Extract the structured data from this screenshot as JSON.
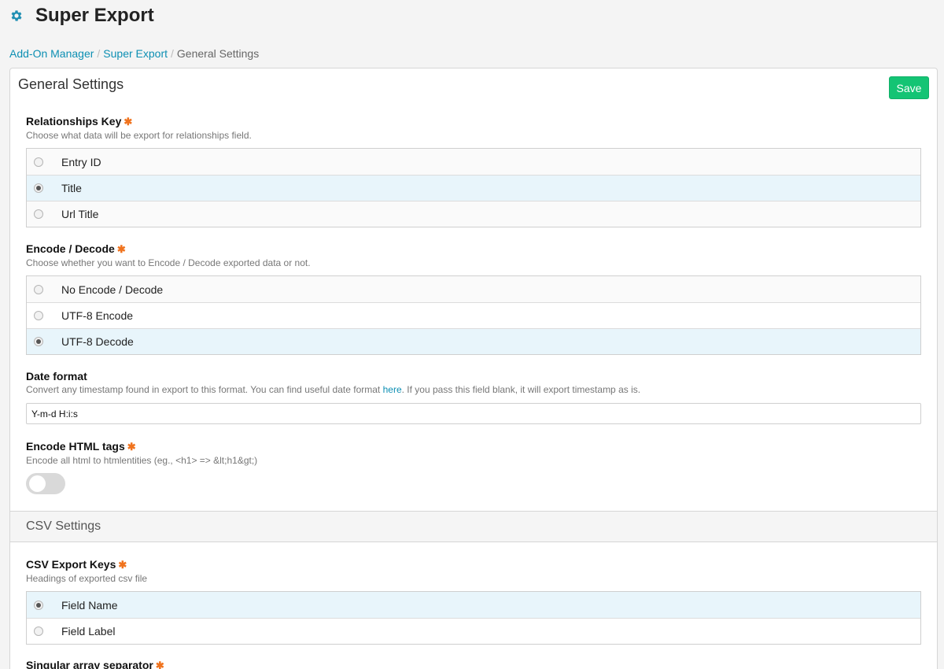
{
  "header": {
    "title": "Super Export",
    "icon": "gear-icon",
    "icon_color": "#1f8fb3"
  },
  "breadcrumb": {
    "items": [
      "Add-On Manager",
      "Super Export"
    ],
    "separator": "/",
    "current": "General Settings"
  },
  "panel": {
    "title": "General Settings",
    "save_label": "Save",
    "save_color": "#14c474"
  },
  "relationships_key": {
    "label": "Relationships Key",
    "required": "✱",
    "description": "Choose what data will be export for relationships field.",
    "options": [
      "Entry ID",
      "Title",
      "Url Title"
    ],
    "selected": "Title"
  },
  "encode_decode": {
    "label": "Encode / Decode",
    "required": "✱",
    "description": "Choose whether you want to Encode / Decode exported data or not.",
    "options": [
      "No Encode / Decode",
      "UTF-8 Encode",
      "UTF-8 Decode"
    ],
    "selected": "UTF-8 Decode"
  },
  "date_format": {
    "label": "Date format",
    "description_before": "Convert any timestamp found in export to this format. You can find useful date format ",
    "link_text": "here",
    "description_after": ". If you pass this field blank, it will export timestamp as is.",
    "value": "Y-m-d H:i:s"
  },
  "encode_html": {
    "label": "Encode HTML tags",
    "required": "✱",
    "description": "Encode all html to htmlentities (eg., <h1> => &lt;h1&gt;)",
    "enabled": false
  },
  "csv_section": {
    "title": "CSV Settings"
  },
  "csv_export_keys": {
    "label": "CSV Export Keys",
    "required": "✱",
    "description": "Headings of exported csv file",
    "options": [
      "Field Name",
      "Field Label"
    ],
    "selected": "Field Name"
  },
  "singular_separator": {
    "label": "Singular array separator",
    "required": "✱"
  }
}
